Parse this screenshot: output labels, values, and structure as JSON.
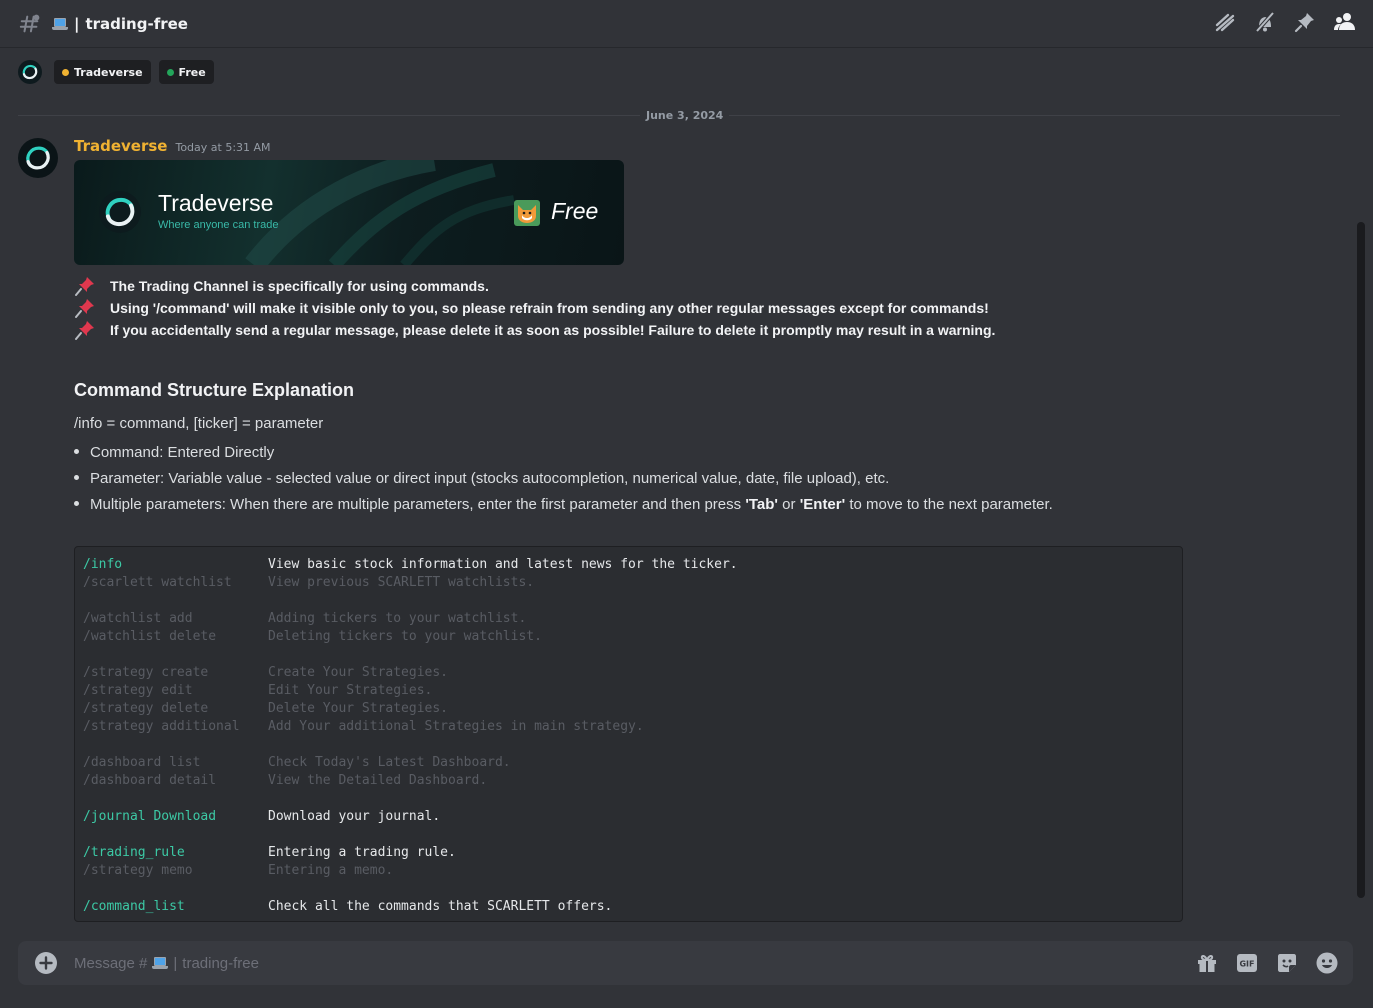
{
  "channel": {
    "name": "trading-free",
    "separator": "|"
  },
  "tags": [
    {
      "label": "Tradeverse",
      "color": "#f0b232"
    },
    {
      "label": "Free",
      "color": "#23a55a"
    }
  ],
  "date_divider": "June 3, 2024",
  "message": {
    "author": "Tradeverse",
    "author_color": "#f0b232",
    "timestamp": "Today at 5:31 AM",
    "banner": {
      "title": "Tradeverse",
      "subtitle": "Where anyone can trade",
      "badge": "Free"
    },
    "rules": [
      "The Trading Channel is specifically for using commands.",
      "Using '/command' will make it visible only to you, so please refrain from sending any other regular messages except for commands!",
      "If you accidentally send a regular message, please delete it as soon as possible! Failure to delete it promptly may result in a warning."
    ],
    "section_title": "Command Structure Explanation",
    "definition": "/info = command, [ticker] = parameter",
    "bullets": [
      {
        "text": "Command: Entered Directly"
      },
      {
        "text": "Parameter: Variable value - selected value or direct input (stocks autocompletion, numerical value, date, file upload), etc."
      },
      {
        "pre": "Multiple parameters: When there are multiple parameters, enter the first parameter and then press ",
        "key1": "'Tab'",
        "mid": " or ",
        "key2": "'Enter'",
        "post": " to move to the next parameter."
      }
    ],
    "commands": [
      {
        "cmd": "/info",
        "desc": "View basic stock information and latest news for the ticker.",
        "style": "bright"
      },
      {
        "cmd": "/scarlett watchlist",
        "desc": "View previous SCARLETT watchlists.",
        "style": "dim"
      },
      {
        "gap": true
      },
      {
        "cmd": "/watchlist add",
        "desc": "Adding tickers to your watchlist.",
        "style": "dim"
      },
      {
        "cmd": "/watchlist delete",
        "desc": "Deleting tickers to your watchlist.",
        "style": "dim"
      },
      {
        "gap": true
      },
      {
        "cmd": "/strategy create",
        "desc": "Create Your Strategies.",
        "style": "dim"
      },
      {
        "cmd": "/strategy edit",
        "desc": "Edit Your Strategies.",
        "style": "dim"
      },
      {
        "cmd": "/strategy delete",
        "desc": "Delete Your Strategies.",
        "style": "dim"
      },
      {
        "cmd": "/strategy additional",
        "desc": "Add Your additional Strategies in main strategy.",
        "style": "dim"
      },
      {
        "gap": true
      },
      {
        "cmd": "/dashboard list",
        "desc": "Check Today's Latest Dashboard.",
        "style": "dim"
      },
      {
        "cmd": "/dashboard detail",
        "desc": "View the Detailed Dashboard.",
        "style": "dim"
      },
      {
        "gap": true
      },
      {
        "cmd": "/journal Download",
        "desc": "Download your journal.",
        "style": "bright"
      },
      {
        "gap": true
      },
      {
        "cmd": "/trading_rule",
        "desc": "Entering a trading rule.",
        "style": "bright"
      },
      {
        "cmd": "/strategy memo",
        "desc": "Entering a memo.",
        "style": "dim"
      },
      {
        "gap": true
      },
      {
        "cmd": "/command_list",
        "desc": "Check all the commands that SCARLETT offers.",
        "style": "bright"
      }
    ]
  },
  "composer": {
    "placeholder_prefix": "Message #",
    "separator": "|",
    "channel": "trading-free"
  },
  "icons": {
    "header": [
      "threads-icon",
      "mute-bell-icon",
      "pin-icon",
      "members-icon"
    ],
    "composer": [
      "gift-icon",
      "gif-icon",
      "sticker-icon",
      "emoji-icon"
    ]
  }
}
